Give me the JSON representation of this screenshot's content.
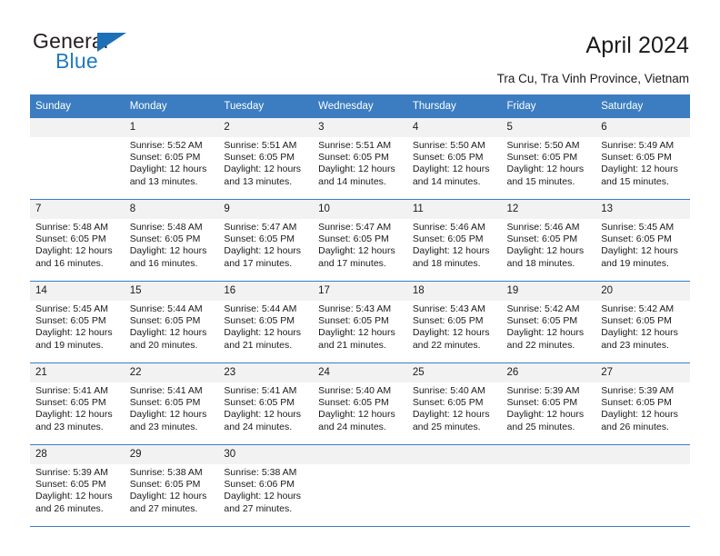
{
  "brand": {
    "name_part1": "General",
    "name_part2": "Blue",
    "accent_color": "#1d6fb8"
  },
  "header": {
    "title": "April 2024",
    "location": "Tra Cu, Tra Vinh Province, Vietnam"
  },
  "calendar": {
    "header_bg": "#3b7dc0",
    "daynum_bg": "#f2f2f2",
    "columns": [
      "Sunday",
      "Monday",
      "Tuesday",
      "Wednesday",
      "Thursday",
      "Friday",
      "Saturday"
    ],
    "weeks": [
      [
        {
          "day": "",
          "lines": []
        },
        {
          "day": "1",
          "lines": [
            "Sunrise: 5:52 AM",
            "Sunset: 6:05 PM",
            "Daylight: 12 hours",
            "and 13 minutes."
          ]
        },
        {
          "day": "2",
          "lines": [
            "Sunrise: 5:51 AM",
            "Sunset: 6:05 PM",
            "Daylight: 12 hours",
            "and 13 minutes."
          ]
        },
        {
          "day": "3",
          "lines": [
            "Sunrise: 5:51 AM",
            "Sunset: 6:05 PM",
            "Daylight: 12 hours",
            "and 14 minutes."
          ]
        },
        {
          "day": "4",
          "lines": [
            "Sunrise: 5:50 AM",
            "Sunset: 6:05 PM",
            "Daylight: 12 hours",
            "and 14 minutes."
          ]
        },
        {
          "day": "5",
          "lines": [
            "Sunrise: 5:50 AM",
            "Sunset: 6:05 PM",
            "Daylight: 12 hours",
            "and 15 minutes."
          ]
        },
        {
          "day": "6",
          "lines": [
            "Sunrise: 5:49 AM",
            "Sunset: 6:05 PM",
            "Daylight: 12 hours",
            "and 15 minutes."
          ]
        }
      ],
      [
        {
          "day": "7",
          "lines": [
            "Sunrise: 5:48 AM",
            "Sunset: 6:05 PM",
            "Daylight: 12 hours",
            "and 16 minutes."
          ]
        },
        {
          "day": "8",
          "lines": [
            "Sunrise: 5:48 AM",
            "Sunset: 6:05 PM",
            "Daylight: 12 hours",
            "and 16 minutes."
          ]
        },
        {
          "day": "9",
          "lines": [
            "Sunrise: 5:47 AM",
            "Sunset: 6:05 PM",
            "Daylight: 12 hours",
            "and 17 minutes."
          ]
        },
        {
          "day": "10",
          "lines": [
            "Sunrise: 5:47 AM",
            "Sunset: 6:05 PM",
            "Daylight: 12 hours",
            "and 17 minutes."
          ]
        },
        {
          "day": "11",
          "lines": [
            "Sunrise: 5:46 AM",
            "Sunset: 6:05 PM",
            "Daylight: 12 hours",
            "and 18 minutes."
          ]
        },
        {
          "day": "12",
          "lines": [
            "Sunrise: 5:46 AM",
            "Sunset: 6:05 PM",
            "Daylight: 12 hours",
            "and 18 minutes."
          ]
        },
        {
          "day": "13",
          "lines": [
            "Sunrise: 5:45 AM",
            "Sunset: 6:05 PM",
            "Daylight: 12 hours",
            "and 19 minutes."
          ]
        }
      ],
      [
        {
          "day": "14",
          "lines": [
            "Sunrise: 5:45 AM",
            "Sunset: 6:05 PM",
            "Daylight: 12 hours",
            "and 19 minutes."
          ]
        },
        {
          "day": "15",
          "lines": [
            "Sunrise: 5:44 AM",
            "Sunset: 6:05 PM",
            "Daylight: 12 hours",
            "and 20 minutes."
          ]
        },
        {
          "day": "16",
          "lines": [
            "Sunrise: 5:44 AM",
            "Sunset: 6:05 PM",
            "Daylight: 12 hours",
            "and 21 minutes."
          ]
        },
        {
          "day": "17",
          "lines": [
            "Sunrise: 5:43 AM",
            "Sunset: 6:05 PM",
            "Daylight: 12 hours",
            "and 21 minutes."
          ]
        },
        {
          "day": "18",
          "lines": [
            "Sunrise: 5:43 AM",
            "Sunset: 6:05 PM",
            "Daylight: 12 hours",
            "and 22 minutes."
          ]
        },
        {
          "day": "19",
          "lines": [
            "Sunrise: 5:42 AM",
            "Sunset: 6:05 PM",
            "Daylight: 12 hours",
            "and 22 minutes."
          ]
        },
        {
          "day": "20",
          "lines": [
            "Sunrise: 5:42 AM",
            "Sunset: 6:05 PM",
            "Daylight: 12 hours",
            "and 23 minutes."
          ]
        }
      ],
      [
        {
          "day": "21",
          "lines": [
            "Sunrise: 5:41 AM",
            "Sunset: 6:05 PM",
            "Daylight: 12 hours",
            "and 23 minutes."
          ]
        },
        {
          "day": "22",
          "lines": [
            "Sunrise: 5:41 AM",
            "Sunset: 6:05 PM",
            "Daylight: 12 hours",
            "and 23 minutes."
          ]
        },
        {
          "day": "23",
          "lines": [
            "Sunrise: 5:41 AM",
            "Sunset: 6:05 PM",
            "Daylight: 12 hours",
            "and 24 minutes."
          ]
        },
        {
          "day": "24",
          "lines": [
            "Sunrise: 5:40 AM",
            "Sunset: 6:05 PM",
            "Daylight: 12 hours",
            "and 24 minutes."
          ]
        },
        {
          "day": "25",
          "lines": [
            "Sunrise: 5:40 AM",
            "Sunset: 6:05 PM",
            "Daylight: 12 hours",
            "and 25 minutes."
          ]
        },
        {
          "day": "26",
          "lines": [
            "Sunrise: 5:39 AM",
            "Sunset: 6:05 PM",
            "Daylight: 12 hours",
            "and 25 minutes."
          ]
        },
        {
          "day": "27",
          "lines": [
            "Sunrise: 5:39 AM",
            "Sunset: 6:05 PM",
            "Daylight: 12 hours",
            "and 26 minutes."
          ]
        }
      ],
      [
        {
          "day": "28",
          "lines": [
            "Sunrise: 5:39 AM",
            "Sunset: 6:05 PM",
            "Daylight: 12 hours",
            "and 26 minutes."
          ]
        },
        {
          "day": "29",
          "lines": [
            "Sunrise: 5:38 AM",
            "Sunset: 6:05 PM",
            "Daylight: 12 hours",
            "and 27 minutes."
          ]
        },
        {
          "day": "30",
          "lines": [
            "Sunrise: 5:38 AM",
            "Sunset: 6:06 PM",
            "Daylight: 12 hours",
            "and 27 minutes."
          ]
        },
        {
          "day": "",
          "lines": []
        },
        {
          "day": "",
          "lines": []
        },
        {
          "day": "",
          "lines": []
        },
        {
          "day": "",
          "lines": []
        }
      ]
    ]
  }
}
